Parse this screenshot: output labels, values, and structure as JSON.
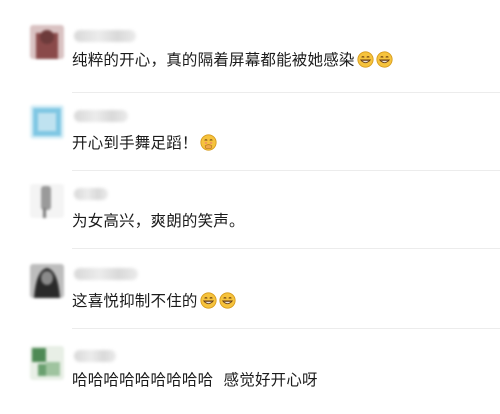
{
  "comments": [
    {
      "text": "纯粹的开心，真的隔着屏幕都能被她感染",
      "emojis": [
        "grinning-emoji",
        "grinning-emoji"
      ],
      "avatar_colors": [
        "#8a4a4a",
        "#c9a7a7",
        "#6d3b3b"
      ]
    },
    {
      "text": "开心到手舞足蹈！",
      "emojis": [
        "hand-over-mouth-emoji"
      ],
      "avatar_colors": [
        "#7fc7e3",
        "#d7eef7",
        "#8bb8cf"
      ]
    },
    {
      "text": "为女高兴，爽朗的笑声。",
      "emojis": [],
      "avatar_colors": [
        "#b8b8b8",
        "#f2f2f2",
        "#7b7b7b"
      ]
    },
    {
      "text": "这喜悦抑制不住的",
      "emojis": [
        "grinning-emoji",
        "grinning-emoji"
      ],
      "avatar_colors": [
        "#2a2a2a",
        "#8a8a8a",
        "#4d4d4d"
      ]
    },
    {
      "text": "哈哈哈哈哈哈哈哈哈  感觉好开心呀",
      "emojis": [],
      "avatar_colors": [
        "#4e8a55",
        "#d9e6d6",
        "#6aa06f"
      ]
    }
  ],
  "colors": {
    "text": "#1b1b1b",
    "divider": "#ececec",
    "emoji_yellow": "#f6c33d"
  }
}
